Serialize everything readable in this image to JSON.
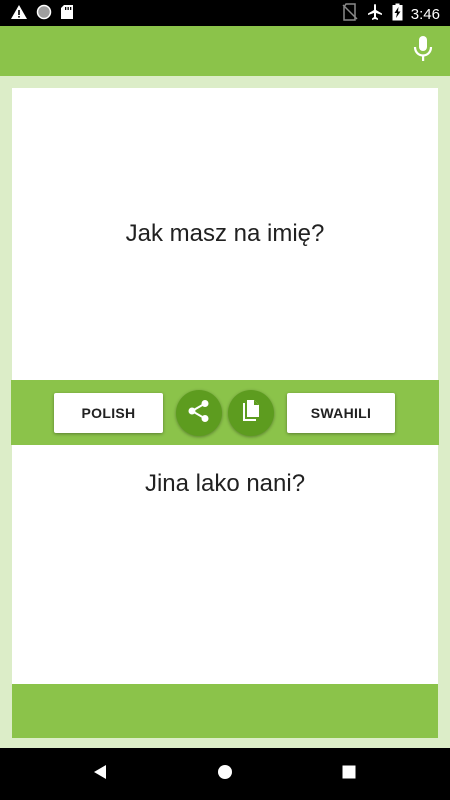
{
  "status_bar": {
    "time": "3:46",
    "icons": [
      "warning-icon",
      "circle-icon",
      "sd-card-icon",
      "no-sim-icon",
      "airplane-icon",
      "battery-charging-icon"
    ]
  },
  "app_bar": {
    "mic_icon": "mic-icon"
  },
  "translation": {
    "source_text": "Jak masz na imię?",
    "target_text": "Jina lako nani?"
  },
  "controls": {
    "source_language": "POLISH",
    "target_language": "SWAHILI",
    "share_icon": "share-icon",
    "copy_icon": "copy-icon"
  },
  "navigation": {
    "back_icon": "back-icon",
    "home_icon": "home-icon",
    "recents_icon": "recents-icon"
  },
  "colors": {
    "accent": "#8bc34a",
    "accent_dark": "#5d9c1f",
    "background": "#dcedc8"
  }
}
